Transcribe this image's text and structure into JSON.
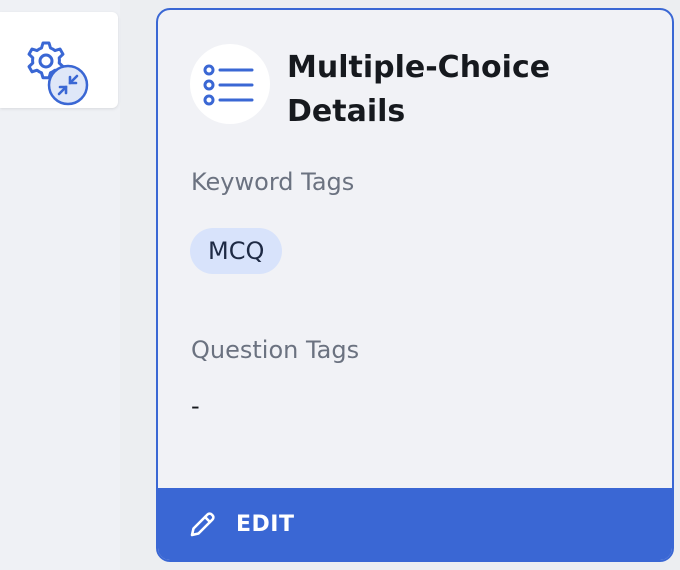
{
  "sidebar": {
    "settings_icon": "settings-collapse-icon"
  },
  "card": {
    "icon": "list-options-icon",
    "title": "Multiple-Choice Details",
    "keyword_tags_label": "Keyword Tags",
    "keyword_tags": [
      "MCQ"
    ],
    "question_tags_label": "Question Tags",
    "question_tags_value": "-",
    "edit_label": "EDIT",
    "edit_icon": "pencil-icon"
  },
  "colors": {
    "accent": "#3a67d4",
    "chip_bg": "#d8e3fb",
    "card_bg": "#f1f2f6"
  }
}
